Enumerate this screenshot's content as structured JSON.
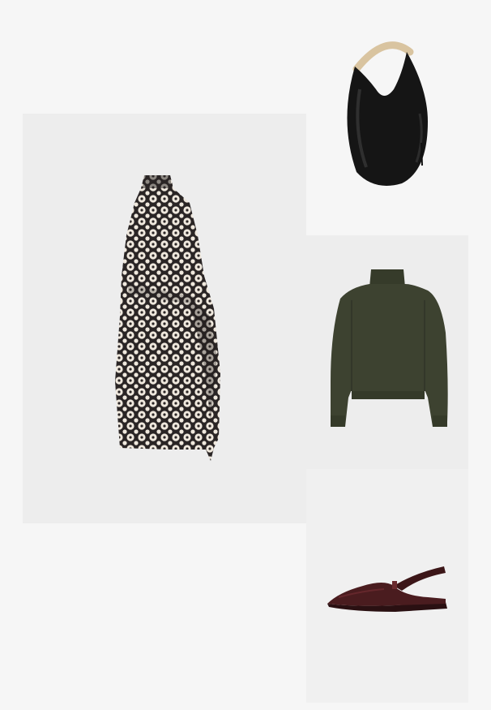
{
  "board": {
    "background": "#f6f6f6",
    "items": [
      {
        "item": "dress",
        "icon": "printed-halter-wrap-dress",
        "colors": {
          "base": "#2a2525",
          "pattern": "#efe8dd"
        }
      },
      {
        "item": "bag",
        "icon": "black-leather-crescent-bag",
        "colors": {
          "body": "#151515",
          "handle": "#d9c4a0"
        }
      },
      {
        "item": "sweater",
        "icon": "green-turtleneck-sweater",
        "colors": {
          "body": "#3d4230"
        }
      },
      {
        "item": "shoes",
        "icon": "burgundy-slingback-flat",
        "colors": {
          "body": "#4a1c1f"
        }
      }
    ]
  }
}
